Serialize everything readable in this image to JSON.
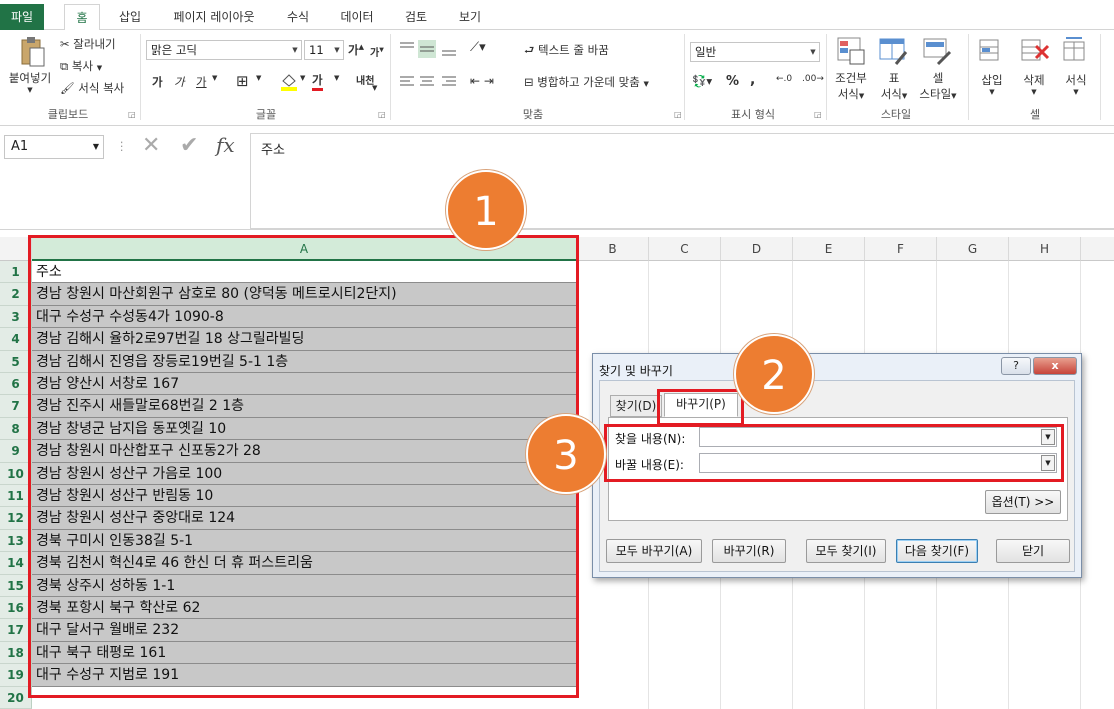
{
  "tabs": [
    "파일",
    "홈",
    "삽입",
    "페이지 레이아웃",
    "수식",
    "데이터",
    "검토",
    "보기"
  ],
  "ribbon": {
    "clipboard": {
      "paste": "붙여넣기",
      "cut": "잘라내기",
      "copy": "복사",
      "format_painter": "서식 복사",
      "label": "클립보드"
    },
    "font": {
      "name": "맑은 고딕",
      "size": "11",
      "grow": "가",
      "shrink": "가",
      "bold": "가",
      "italic": "가",
      "underline": "가",
      "color": "가",
      "phonetic": "내천",
      "label": "글꼴"
    },
    "align": {
      "wrap": "텍스트 줄 바꿈",
      "merge": "병합하고 가운데 맞춤",
      "label": "맞춤"
    },
    "number": {
      "format": "일반",
      "percent": "%",
      "comma": ",",
      "label": "표시 형식"
    },
    "styles": {
      "conditional_1": "조건부",
      "conditional_2": "서식",
      "table_1": "표",
      "table_2": "서식",
      "cell_1": "셀",
      "cell_2": "스타일",
      "label": "스타일"
    },
    "cells": {
      "insert": "삽입",
      "delete": "삭제",
      "format": "서식",
      "label": "셀"
    }
  },
  "formula_bar": {
    "name_box": "A1",
    "fx": "fx",
    "content": "주소"
  },
  "sheet": {
    "columns": [
      "A",
      "B",
      "C",
      "D",
      "E",
      "F",
      "G",
      "H"
    ],
    "row_numbers": [
      "1",
      "2",
      "3",
      "4",
      "5",
      "6",
      "7",
      "8",
      "9",
      "10",
      "11",
      "12",
      "13",
      "14",
      "15",
      "16",
      "17",
      "18",
      "19",
      "20"
    ],
    "cells_a": [
      "주소",
      "경남 창원시 마산회원구 삼호로 80 (양덕동 메트로시티2단지)",
      "대구 수성구 수성동4가 1090-8",
      "경남 김해시 율하2로97번길 18 상그릴라빌딩",
      "경남 김해시 진영읍 장등로19번길 5-1 1층",
      "경남 양산시 서창로 167",
      "경남 진주시 새들말로68번길 2 1층",
      "경남 창녕군 남지읍 동포옛길 10",
      "경남 창원시 마산합포구 신포동2가 28",
      "경남 창원시 성산구 가음로 100",
      "경남 창원시 성산구 반림동 10",
      "경남 창원시 성산구 중앙대로 124",
      "경북 구미시 인동38길 5-1",
      "경북 김천시 혁신4로 46 한신 더 휴 퍼스트리움",
      "경북 상주시 성하동 1-1",
      "경북 포항시 북구 학산로 62",
      "대구 달서구 월배로 232",
      "대구 북구 태평로 161",
      "대구 수성구 지범로 191"
    ]
  },
  "callouts": [
    "1",
    "2",
    "3"
  ],
  "dialog": {
    "title": "찾기 및 바꾸기",
    "help": "?",
    "close": "x",
    "tab_find": "찾기(D)",
    "tab_replace": "바꾸기(P)",
    "find_label": "찾을 내용(N):",
    "replace_label": "바꿀 내용(E):",
    "find_value": "",
    "replace_value": "",
    "options": "옵션(T) >>",
    "replace_all": "모두 바꾸기(A)",
    "replace": "바꾸기(R)",
    "find_all": "모두 찾기(I)",
    "find_next": "다음 찾기(F)",
    "close_btn": "닫기"
  },
  "colors": {
    "excel_green": "#217346",
    "highlight_red": "#e31b23",
    "callout_orange": "#ed7d31",
    "selection_gray": "#c8c8c8"
  }
}
